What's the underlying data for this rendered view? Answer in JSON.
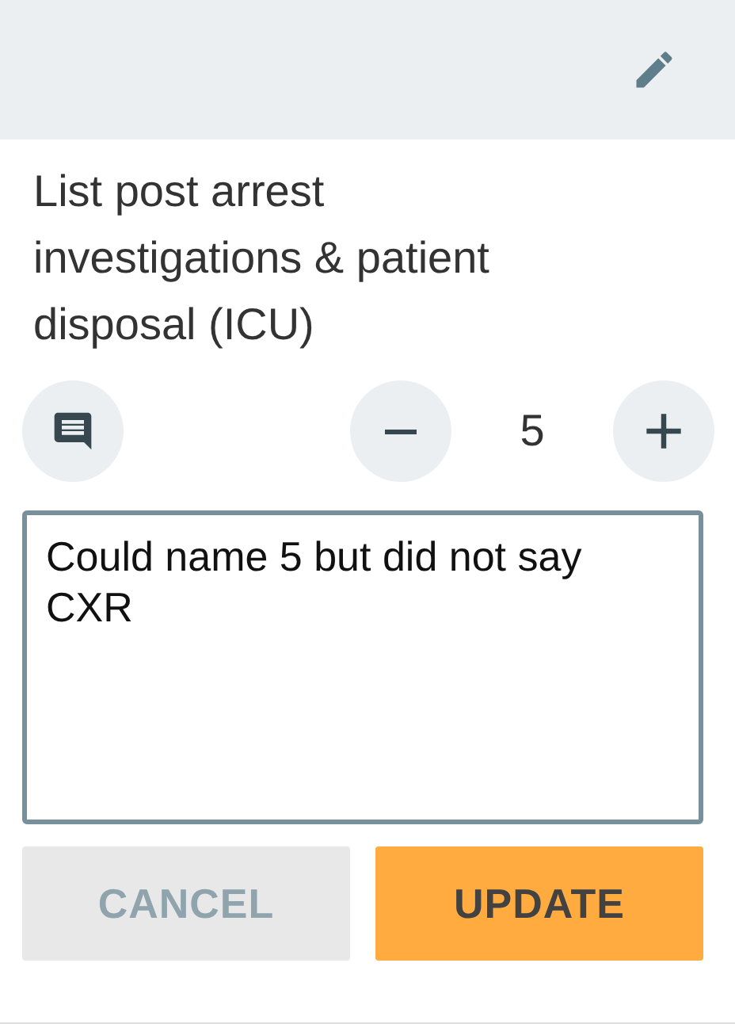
{
  "question": "List post arrest investigations & patient disposal (ICU)",
  "score": {
    "value": "5"
  },
  "comment": {
    "value": "Could name 5 but did not say CXR"
  },
  "buttons": [
    {
      "label": "CANCEL",
      "kind": "secondary"
    },
    {
      "label": "UPDATE",
      "kind": "primary"
    }
  ]
}
